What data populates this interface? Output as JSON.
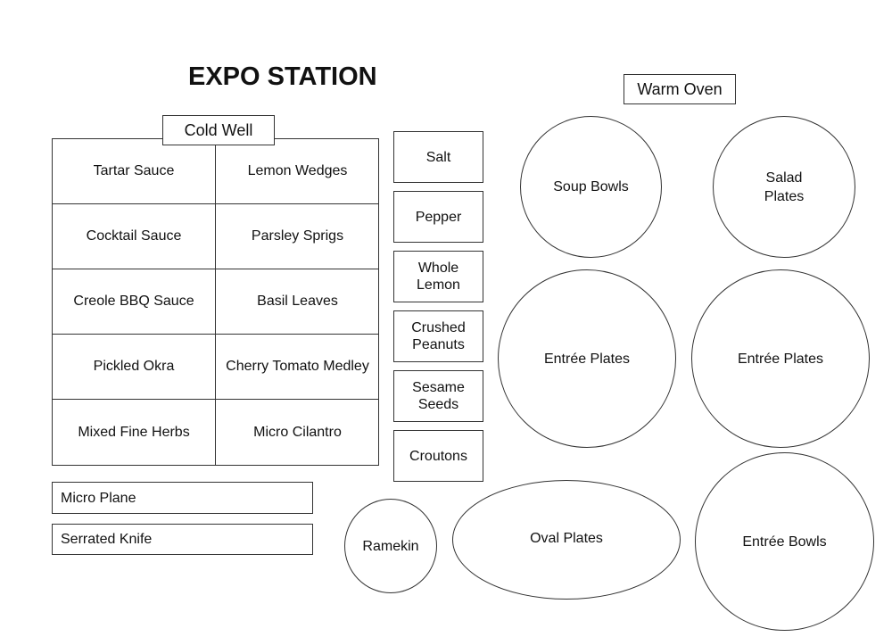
{
  "title": "EXPO STATION",
  "cold_well": {
    "label": "Cold Well",
    "cells": [
      "Tartar Sauce",
      "Lemon Wedges",
      "Cocktail Sauce",
      "Parsley Sprigs",
      "Creole BBQ Sauce",
      "Basil Leaves",
      "Pickled Okra",
      "Cherry Tomato Medley",
      "Mixed Fine Herbs",
      "Micro Cilantro"
    ]
  },
  "tools": [
    "Micro Plane",
    "Serrated Knife"
  ],
  "condiments": [
    [
      "Salt"
    ],
    [
      "Pepper"
    ],
    [
      "Whole",
      "Lemon"
    ],
    [
      "Crushed",
      "Peanuts"
    ],
    [
      "Sesame",
      "Seeds"
    ],
    [
      "Croutons"
    ]
  ],
  "warm_oven": {
    "label": "Warm Oven",
    "items": {
      "soup_bowls": "Soup Bowls",
      "salad_plates": [
        "Salad",
        "Plates"
      ],
      "entree_plates_1": "Entrée Plates",
      "entree_plates_2": "Entrée Plates",
      "ramekin": "Ramekin",
      "oval_plates": "Oval Plates",
      "entree_bowls": "Entrée Bowls"
    }
  }
}
